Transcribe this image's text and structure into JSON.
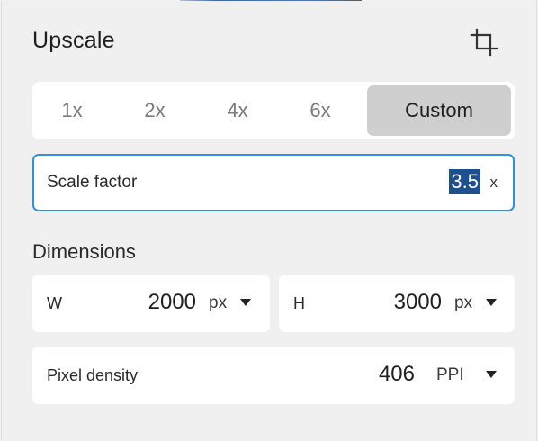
{
  "panel": {
    "title": "Upscale",
    "crop_icon": "crop-icon"
  },
  "scale_options": [
    {
      "label": "1x",
      "selected": false
    },
    {
      "label": "2x",
      "selected": false
    },
    {
      "label": "4x",
      "selected": false
    },
    {
      "label": "6x",
      "selected": false
    },
    {
      "label": "Custom",
      "selected": true
    }
  ],
  "scale_factor": {
    "label": "Scale factor",
    "value": "3.5",
    "unit": "x"
  },
  "dimensions": {
    "title": "Dimensions",
    "width": {
      "label": "W",
      "value": "2000",
      "unit": "px"
    },
    "height": {
      "label": "H",
      "value": "3000",
      "unit": "px"
    }
  },
  "pixel_density": {
    "label": "Pixel density",
    "value": "406",
    "unit": "PPI"
  },
  "colors": {
    "accent": "#2f8fe0",
    "selection": "#1e4f8f",
    "segment_active": "#cfcfcf",
    "panel_bg": "#f0f0f0"
  }
}
